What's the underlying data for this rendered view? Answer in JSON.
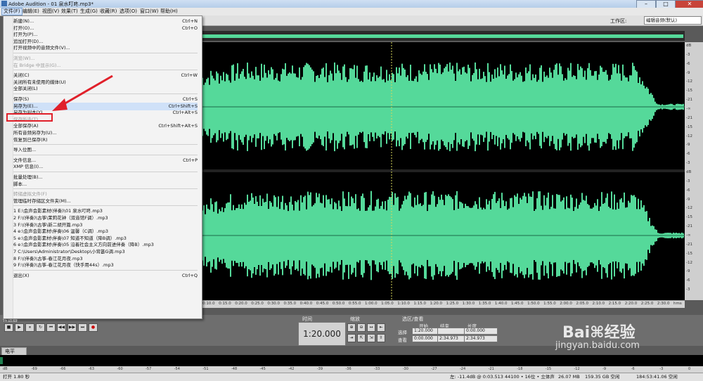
{
  "window": {
    "title": "Adobe Audition - 01 泉水叮咚.mp3*",
    "minimize": "–",
    "maximize": "□",
    "close": "✕"
  },
  "menubar": [
    {
      "label": "文件(F)"
    },
    {
      "label": "编辑(E)"
    },
    {
      "label": "视图(V)"
    },
    {
      "label": "效果(T)"
    },
    {
      "label": "生成(G)"
    },
    {
      "label": "收藏(R)"
    },
    {
      "label": "选项(O)"
    },
    {
      "label": "窗口(W)"
    },
    {
      "label": "帮助(H)"
    }
  ],
  "workspace": {
    "label": "工作区:",
    "value": "编辑音频(默认)"
  },
  "file_menu": [
    {
      "label": "新建(N)...",
      "shortcut": "Ctrl+N",
      "disabled": false
    },
    {
      "label": "打开(O)...",
      "shortcut": "Ctrl+O",
      "disabled": false
    },
    {
      "label": "打开为(P)...",
      "shortcut": "",
      "disabled": false
    },
    {
      "label": "追加打开(D)...",
      "shortcut": "",
      "disabled": false
    },
    {
      "label": "打开视频中的音频文件(V)...",
      "shortcut": "",
      "disabled": false
    },
    {
      "sep": true
    },
    {
      "label": "浏览(W)...",
      "shortcut": "",
      "disabled": true
    },
    {
      "label": "在 Bridge 中显示(G)...",
      "shortcut": "",
      "disabled": true
    },
    {
      "sep": true
    },
    {
      "label": "关闭(C)",
      "shortcut": "Ctrl+W",
      "disabled": false
    },
    {
      "label": "关闭所有未使用的媒体(U)",
      "shortcut": "",
      "disabled": false
    },
    {
      "label": "全部关闭(L)",
      "shortcut": "",
      "disabled": false
    },
    {
      "sep": true
    },
    {
      "label": "保存(S)",
      "shortcut": "Ctrl+S",
      "disabled": false
    },
    {
      "label": "另存为(E)...",
      "shortcut": "Ctrl+Shift+S",
      "disabled": false,
      "highlight": true
    },
    {
      "label": "另存为副本(Y)...",
      "shortcut": "Ctrl+Alt+S",
      "disabled": false
    },
    {
      "label": "保存所选(T)...",
      "shortcut": "",
      "disabled": true
    },
    {
      "label": "全部保存(A)",
      "shortcut": "Ctrl+Shift+Alt+S",
      "disabled": false
    },
    {
      "label": "所有音频另存为(U)...",
      "shortcut": "",
      "disabled": false
    },
    {
      "label": "恢复到已保存(R)",
      "shortcut": "",
      "disabled": false
    },
    {
      "sep": true
    },
    {
      "label": "导入位图...",
      "shortcut": "",
      "disabled": false
    },
    {
      "sep": true
    },
    {
      "label": "文件信息...",
      "shortcut": "Ctrl+P",
      "disabled": false
    },
    {
      "label": "XMP 信息(I)...",
      "shortcut": "",
      "disabled": false
    },
    {
      "sep": true
    },
    {
      "label": "批量处理(B)...",
      "shortcut": "",
      "disabled": false
    },
    {
      "label": "脚本...",
      "shortcut": "",
      "disabled": false
    },
    {
      "sep": true
    },
    {
      "label": "转储虚拟文件(F)",
      "shortcut": "",
      "disabled": true
    },
    {
      "label": "管理临时存储区文件夹(M)...",
      "shortcut": "",
      "disabled": false
    },
    {
      "sep": true
    },
    {
      "label": "1 E:\\会声会影素材(伴奏)\\01 泉水叮咚.mp3",
      "shortcut": "",
      "disabled": false
    },
    {
      "label": "2 F:\\(伴奏)\\古筝\\茉莉花钟（双音馆F调）.mp3",
      "shortcut": "",
      "disabled": false
    },
    {
      "label": "3 F:\\(伴奏)\\古筝\\新二胡开篇.mp3",
      "shortcut": "",
      "disabled": false
    },
    {
      "label": "4 e:\\会声会影素材\\伴奏\\06 温馨（C调）.mp3",
      "shortcut": "",
      "disabled": false
    },
    {
      "label": "5 e:\\会声会影素材\\伴奏\\07 知道不知道（降B调）.mp3",
      "shortcut": "",
      "disabled": false
    },
    {
      "label": "6 e:\\会声会影素材\\伴奏\\05 沿着社会主义方向前进伴奏（降B）.mp3",
      "shortcut": "",
      "disabled": false
    },
    {
      "label": "7 C:\\Users\\Administrator\\Desktop\\小背篓G调.mp3",
      "shortcut": "",
      "disabled": false
    },
    {
      "label": "8 F:\\(伴奏)\\古筝-春江花月夜.mp3",
      "shortcut": "",
      "disabled": false
    },
    {
      "label": "9 F:\\(伴奏)\\古筝-春江花月夜（快手用44s）.mp3",
      "shortcut": "",
      "disabled": false
    },
    {
      "sep": true
    },
    {
      "label": "退出(X)",
      "shortcut": "Ctrl+Q",
      "disabled": false
    }
  ],
  "amp_scale": [
    "dB",
    "-3",
    "-6",
    "-9",
    "-12",
    "-15",
    "-21",
    "-∞",
    "-21",
    "-15",
    "-12",
    "-9",
    "-6",
    "-3",
    "dB",
    "-3",
    "-6",
    "-9",
    "-12",
    "-15",
    "-21",
    "-∞",
    "-21",
    "-15",
    "-12",
    "-9",
    "-6",
    "-3"
  ],
  "timeline": [
    "0:10.0",
    "0:15.0",
    "0:20.0",
    "0:25.0",
    "0:30.0",
    "0:35.0",
    "0:40.0",
    "0:45.0",
    "0:50.0",
    "0:55.0",
    "1:00.0",
    "1:05.0",
    "1:10.0",
    "1:15.0",
    "1:20.0",
    "1:25.0",
    "1:30.0",
    "1:35.0",
    "1:40.0",
    "1:45.0",
    "1:50.0",
    "1:55.0",
    "2:00.0",
    "2:05.0",
    "2:10.0",
    "2:15.0",
    "2:20.0",
    "2:25.0",
    "2:30.0",
    "hms"
  ],
  "transport": {
    "tab": "传送器",
    "buttons": [
      "■",
      "▶",
      "⏸",
      "↻",
      "⏮",
      "◀◀",
      "▶▶",
      "⏭",
      "●"
    ]
  },
  "time_panel": {
    "tab": "时间",
    "value": "1:20.000"
  },
  "zoom_panel": {
    "tab": "缩放"
  },
  "selection_panel": {
    "tab": "选区/查看",
    "headers": [
      "开始",
      "结束",
      "长度"
    ],
    "rows": [
      {
        "label": "选择",
        "start": "1:20.000",
        "end": "",
        "length": "0:00.000"
      },
      {
        "label": "查看",
        "start": "0:00.000",
        "end": "2:34.973",
        "length": "2:34.973"
      }
    ]
  },
  "level_panel": {
    "tab": "电平"
  },
  "meter_scale": [
    "dB",
    "-69",
    "-66",
    "-63",
    "-60",
    "-57",
    "-54",
    "-51",
    "-48",
    "-45",
    "-42",
    "-39",
    "-36",
    "-33",
    "-30",
    "-27",
    "-24",
    "-21",
    "-18",
    "-15",
    "-12",
    "-9",
    "-6",
    "-3",
    "0"
  ],
  "status": {
    "left": "打开 1.80 秒",
    "right": [
      "左: -11.4dB @ 0:03.513",
      "44100 • 16位 • 立体声",
      "26.07 MB",
      "159.35 GB 空闲",
      "184:53:41.06 空闲"
    ]
  },
  "watermark": {
    "brand": "Bai⌘经验",
    "url": "jingyan.baidu.com"
  },
  "colors": {
    "waveform": "#55d99a",
    "highlight_box": "#e0202a"
  }
}
